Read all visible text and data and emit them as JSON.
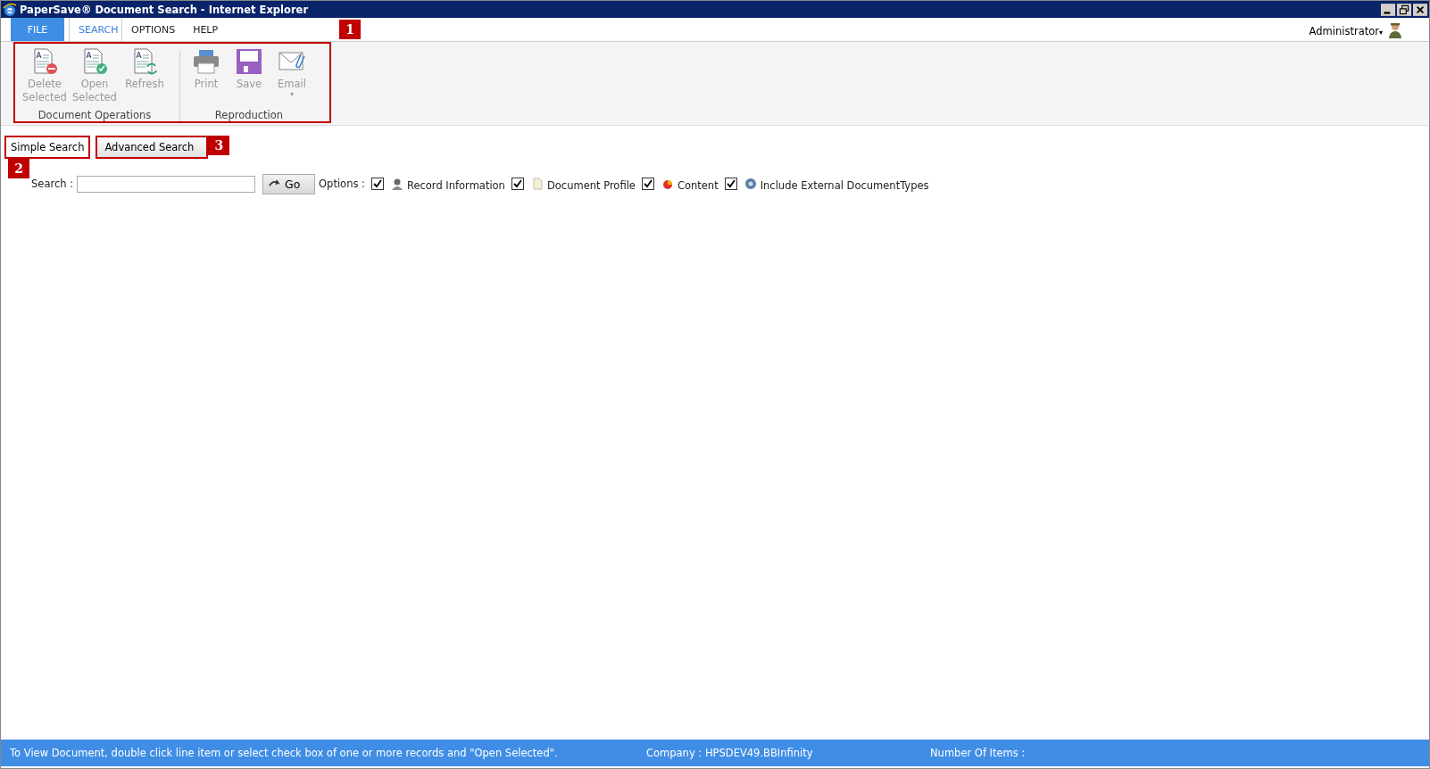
{
  "window": {
    "title": "PaperSave® Document Search - Internet Explorer"
  },
  "menu": [
    {
      "label": "FILE",
      "kind": "file",
      "selected": false
    },
    {
      "label": "SEARCH",
      "kind": "tab",
      "selected": true
    },
    {
      "label": "OPTIONS",
      "kind": "tab",
      "selected": false
    },
    {
      "label": "HELP",
      "kind": "tab",
      "selected": false
    }
  ],
  "user": {
    "name": "Administrator",
    "caret": "▾"
  },
  "ribbon": {
    "callout": "1",
    "groups": [
      {
        "title": "Document Operations",
        "buttons": [
          {
            "label": "Delete Selected",
            "kind": "delete",
            "disabled": true
          },
          {
            "label": "Open Selected",
            "kind": "open",
            "disabled": true
          },
          {
            "label": "Refresh",
            "kind": "refresh",
            "disabled": true
          }
        ]
      },
      {
        "title": "Reproduction",
        "buttons": [
          {
            "label": "Print",
            "kind": "print",
            "disabled": true
          },
          {
            "label": "Save",
            "kind": "save",
            "disabled": true
          },
          {
            "label": "Email",
            "kind": "email",
            "disabled": true,
            "caret": "▾"
          }
        ]
      }
    ]
  },
  "search_tabs": [
    {
      "label": "Simple Search",
      "selected": true,
      "callout": "2"
    },
    {
      "label": "Advanced Search",
      "selected": false,
      "callout": "3"
    }
  ],
  "search": {
    "label": "Search :",
    "button": "Go",
    "options_label": "Options :",
    "options": [
      {
        "label": "Record Information",
        "kind": "record",
        "checked": true
      },
      {
        "label": "Document Profile",
        "kind": "profile",
        "checked": true
      },
      {
        "label": "Content",
        "kind": "content",
        "checked": true
      },
      {
        "label": "Include External DocumentTypes",
        "kind": "external",
        "checked": true
      }
    ]
  },
  "status_bar": {
    "hint": "To View Document, double click line item or select check box of one or more records and \"Open Selected\".",
    "company": "Company : HPSDEV49.BBInfinity",
    "items": "Number Of Items :"
  }
}
